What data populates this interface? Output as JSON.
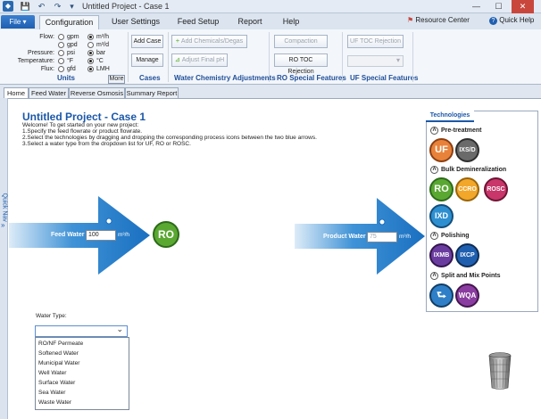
{
  "window": {
    "title": "Untitled Project - Case 1",
    "controls": {
      "minimize": "—",
      "maximize": "☐",
      "close": "✕"
    }
  },
  "ribbon_tabs": {
    "file": "File ▾",
    "tabs": [
      "Configuration",
      "User Settings",
      "Feed Setup",
      "Report",
      "Help"
    ],
    "active": "Configuration",
    "resource_center": "Resource Center",
    "quick_help": "Quick Help"
  },
  "units": {
    "rows": [
      {
        "label": "Flow:",
        "opt1": "gpm",
        "opt2": "m³/h",
        "selected": 2
      },
      {
        "label": "",
        "opt1": "gpd",
        "opt2": "m³/d",
        "selected": 0
      },
      {
        "label": "Pressure:",
        "opt1": "psi",
        "opt2": "bar",
        "selected": 2
      },
      {
        "label": "Temperature:",
        "opt1": "°F",
        "opt2": "°C",
        "selected": 2
      },
      {
        "label": "Flux:",
        "opt1": "gfd",
        "opt2": "LMH",
        "selected": 2
      }
    ],
    "more": "More",
    "group_label": "Units"
  },
  "cases": {
    "add_case": "Add Case",
    "manage": "Manage",
    "group_label": "Cases"
  },
  "water_chem": {
    "add_chem": "Add Chemicals/Degas",
    "adjust_ph": "Adjust Final pH",
    "group_label": "Water Chemistry Adjustments"
  },
  "ro_special": {
    "compaction": "Compaction",
    "ro_toc": "RO TOC Rejection",
    "group_label": "RO Special Features"
  },
  "uf_special": {
    "uf_toc": "UF TOC Rejection",
    "group_label": "UF Special Features"
  },
  "page_tabs": [
    "Home",
    "Feed Water",
    "Reverse Osmosis",
    "Summary Report"
  ],
  "quick_nav": "Quick Nav",
  "main": {
    "project_title": "Untitled Project - Case 1",
    "welcome": [
      "Welcome! To get started on your new project:",
      "1.Specify the feed flowrate or product flowrate.",
      "2.Select the technologies by dragging and dropping the corresponding process icons between the two blue arrows.",
      "3.Select a water type from the dropdown list for UF, RO or ROSC."
    ],
    "feed_water_label": "Feed Water",
    "feed_water_value": "100",
    "feed_unit": "m³/h",
    "product_water_label": "Product Water",
    "product_water_value": "75",
    "product_unit": "m³/h",
    "ro_icon": "RO"
  },
  "technologies": {
    "tab": "Technologies",
    "sections": [
      {
        "title": "Pre-treatment",
        "items": [
          "UF",
          "IXS/D"
        ]
      },
      {
        "title": "Bulk Demineralization",
        "items": [
          "RO",
          "CCRO",
          "ROSC",
          "IXD"
        ]
      },
      {
        "title": "Polishing",
        "items": [
          "IXMB",
          "IXCP"
        ]
      },
      {
        "title": "Split and Mix Points",
        "items": [
          "⮑",
          "WQA"
        ]
      }
    ]
  },
  "water_type": {
    "label": "Water Type:",
    "selected": "",
    "options": [
      "RO/NF Permeate",
      "Softened Water",
      "Municipal Water",
      "Well Water",
      "Surface Water",
      "Sea Water",
      "Waste Water"
    ]
  },
  "colors": {
    "accent": "#1b58a8",
    "uf": "#e8823a",
    "ro_green": "#5aa832",
    "ccro": "#f2a72a",
    "rosc": "#c8366a",
    "ixd": "#2e8fd0",
    "ixmb": "#6b3ca0",
    "ixcp": "#1f5fb0",
    "wqa": "#8a3ca0"
  }
}
